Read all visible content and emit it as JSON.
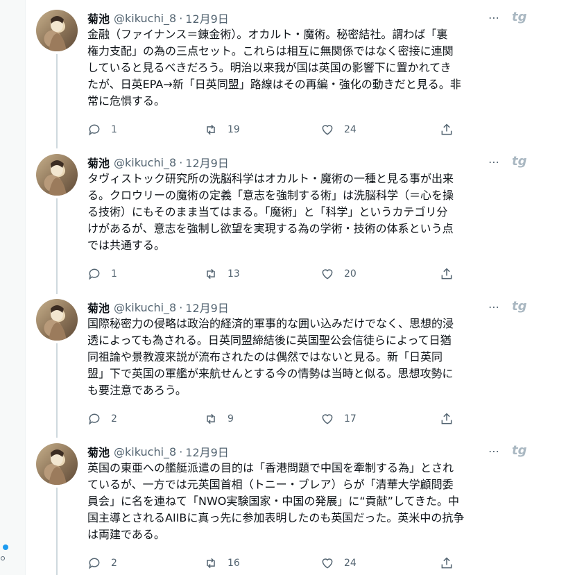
{
  "tweets": [
    {
      "name": "菊池",
      "handle": "@kikuchi_8",
      "separator": "·",
      "date": "12月9日",
      "more_label": "⋯",
      "brand": "tg",
      "lines": [
        "金融（ファイナンス＝錬金術）。オカルト・魔術。秘密結社。謂わば「裏",
        "権力支配」の為の三点セット。これらは相互に無関係ではなく密接に連関",
        "していると見るべきだろう。明治以来我が国は英国の影響下に置かれてき",
        "たが、日英EPA→新「日英同盟」路線はその再編・強化の動きだと見る。非",
        "常に危惧する。"
      ],
      "replies": "1",
      "retweets": "19",
      "likes": "24"
    },
    {
      "name": "菊池",
      "handle": "@kikuchi_8",
      "separator": "·",
      "date": "12月9日",
      "more_label": "⋯",
      "brand": "tg",
      "lines": [
        "タヴィストック研究所の洗脳科学はオカルト・魔術の一種と見る事が出来",
        "る。クロウリーの魔術の定義「意志を強制する術」は洗脳科学（＝心を操",
        "る技術）にもそのまま当てはまる。「魔術」と「科学」というカテゴリ分",
        "けがあるが、意志を強制し欲望を実現する為の学術・技術の体系という点",
        "では共通する。"
      ],
      "replies": "1",
      "retweets": "13",
      "likes": "20"
    },
    {
      "name": "菊池",
      "handle": "@kikuchi_8",
      "separator": "·",
      "date": "12月9日",
      "more_label": "⋯",
      "brand": "tg",
      "lines": [
        "国際秘密力の侵略は政治的経済的軍事的な囲い込みだけでなく、思想的浸",
        "透によっても為される。日英同盟締結後に英国聖公会信徒らによって日猶",
        "同祖論や景教渡来説が流布されたのは偶然ではないと見る。新「日英同",
        "盟」下で英国の軍艦が来航せんとする今の情勢は当時と似る。思想攻勢に",
        "も要注意であろう。"
      ],
      "replies": "2",
      "retweets": "9",
      "likes": "17"
    },
    {
      "name": "菊池",
      "handle": "@kikuchi_8",
      "separator": "·",
      "date": "12月9日",
      "more_label": "⋯",
      "brand": "tg",
      "lines": [
        "英国の東亜への艦艇派遣の目的は「香港問題で中国を牽制する為」とされ",
        "ているが、一方では元英国首相（トニー・ブレア）らが「清華大学顧問委",
        "員会」に名を連ねて「NWO実験国家・中国の発展」に“貢献”してきた。中",
        "国主導とされるAIIBに真っ先に参加表明したのも英国だった。英米中の抗争",
        "は両建である。"
      ],
      "replies": "2",
      "retweets": "16",
      "likes": "24"
    }
  ]
}
